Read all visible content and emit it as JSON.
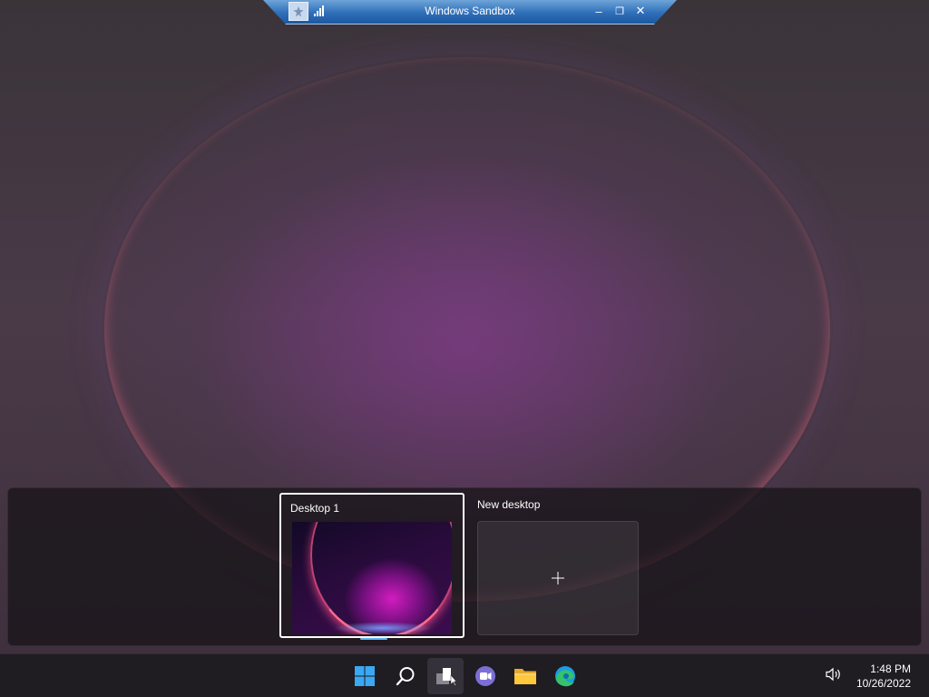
{
  "sandbox": {
    "title": "Windows Sandbox",
    "minimize_glyph": "–",
    "restore_glyph": "❐",
    "close_glyph": "✕"
  },
  "taskview": {
    "desktops": [
      {
        "label": "Desktop 1",
        "selected": true
      }
    ],
    "new_desktop": {
      "label": "New desktop",
      "glyph": "+"
    }
  },
  "taskbar": {
    "icons": [
      "windows-start-icon",
      "search-icon",
      "task-view-icon",
      "teams-chat-icon",
      "file-explorer-icon",
      "edge-icon"
    ],
    "active": "task-view-icon"
  },
  "tray": {
    "time": "1:48 PM",
    "date": "10/26/2022"
  },
  "colors": {
    "sandbox_bar": "#2f6fb9",
    "accent": "#5fb6f0"
  }
}
